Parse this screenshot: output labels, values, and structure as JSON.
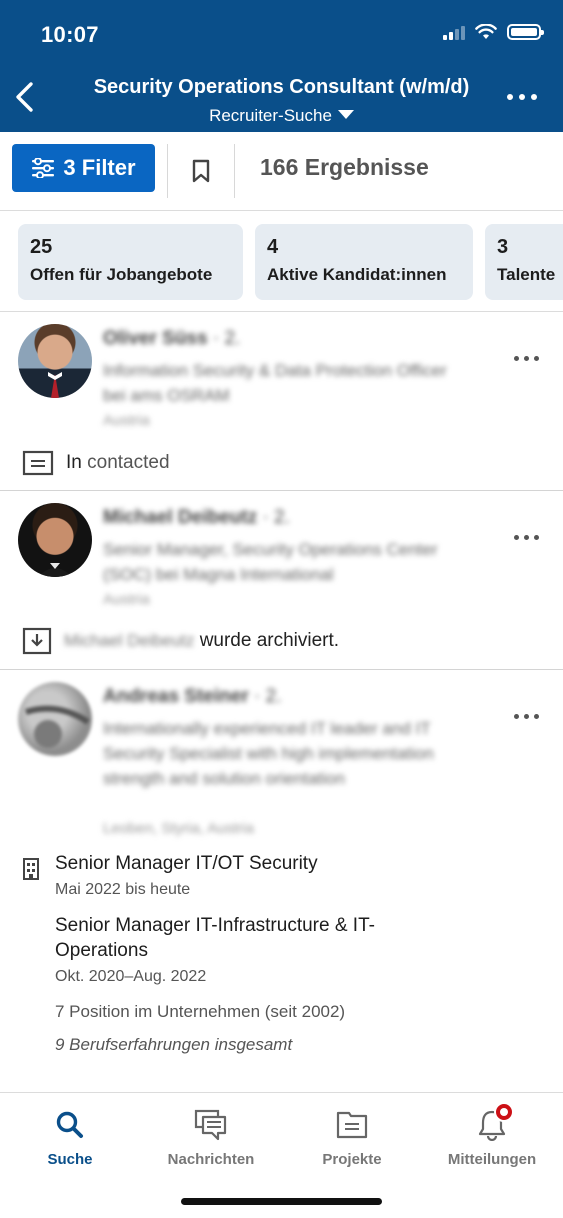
{
  "status": {
    "time": "10:07"
  },
  "header": {
    "title": "Security Operations Consultant (w/m/d)",
    "subtitle": "Recruiter-Suche",
    "color": "#0a4f8a"
  },
  "toolbar": {
    "filter_label": "3 Filter",
    "results": "166 Ergebnisse",
    "accent": "#0a66c2"
  },
  "stats": [
    {
      "count": "25",
      "label": "Offen für Jobangebote"
    },
    {
      "count": "4",
      "label": "Aktive Kandidat:innen"
    },
    {
      "count": "3",
      "label": "Talente"
    }
  ],
  "candidates": [
    {
      "name": "Oliver Süss",
      "degree": "· 2.",
      "headline": "Information Security & Data Protection Officer bei ams OSRAM",
      "location": "Austria",
      "note_prefix": "In",
      "note": "contacted"
    },
    {
      "name": "Michael Deibeutz",
      "degree": "· 2.",
      "headline": "Senior Manager, Security Operations Center (SOC) bei Magna International",
      "location": "Austria",
      "note_name": "Michael Deibeutz",
      "note": "wurde archiviert."
    },
    {
      "name": "Andreas Steiner",
      "degree": "· 2.",
      "headline": "Internationally experienced IT leader and IT Security Specialist with high implementation strength and solution orientation",
      "location": "Leoben, Styria, Austria",
      "experience": [
        {
          "title": "Senior Manager IT/OT Security",
          "dates": "Mai 2022 bis heute"
        },
        {
          "title_line1": "Senior Manager IT-Infrastructure & IT-",
          "title_line2": "Operations",
          "dates": "Okt. 2020–Aug. 2022"
        }
      ],
      "positions_info": "7 Position im Unternehmen (seit 2002)",
      "total_experience": "9 Berufserfahrungen insgesamt"
    }
  ],
  "tabs": [
    {
      "label": "Suche",
      "icon": "search-icon",
      "active": true
    },
    {
      "label": "Nachrichten",
      "icon": "messages-icon"
    },
    {
      "label": "Projekte",
      "icon": "folder-icon"
    },
    {
      "label": "Mitteilungen",
      "icon": "bell-icon"
    }
  ]
}
